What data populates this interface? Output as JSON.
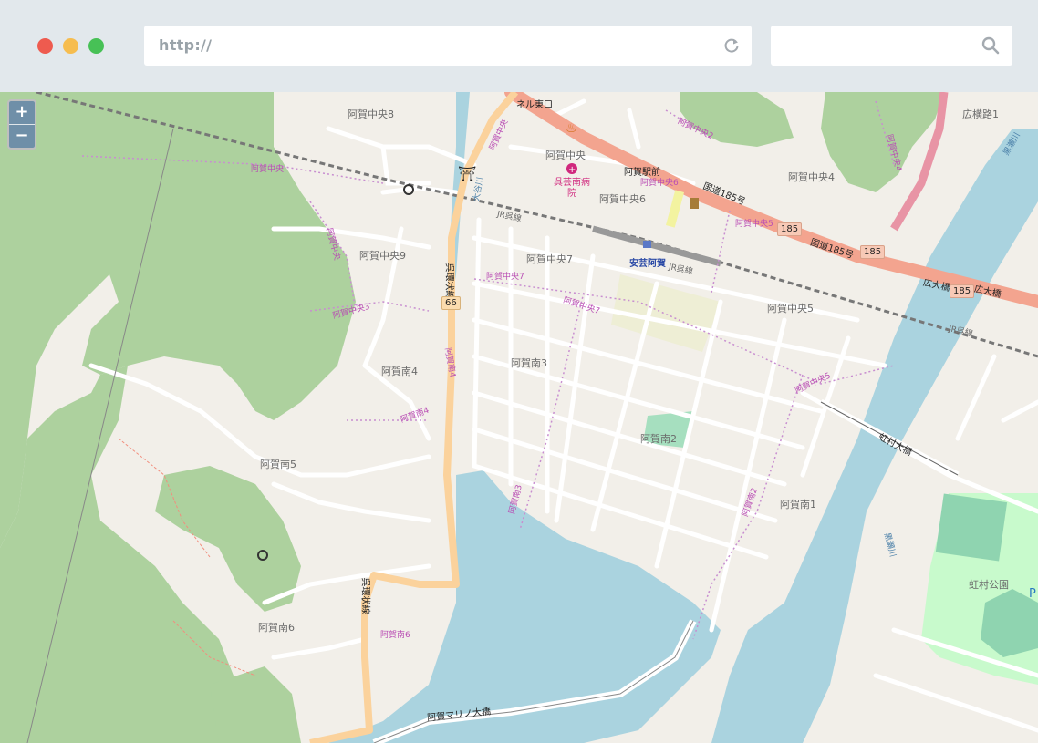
{
  "browser": {
    "url_placeholder": "http://",
    "search_placeholder": "",
    "icons": [
      "close-dot",
      "minimize-dot",
      "maximize-dot",
      "reload-icon",
      "search-icon"
    ],
    "colors": {
      "close": "#ee5b4f",
      "minimize": "#f6bd4f",
      "maximize": "#47c156"
    }
  },
  "map": {
    "zoom_in": "+",
    "zoom_out": "−",
    "labels": {
      "aga_chuo8": "阿賀中央8",
      "aga_chuo": "阿賀中央",
      "aga_chuo6": "阿賀中央6",
      "aga_chuo4": "阿賀中央4",
      "aga_chuo9": "阿賀中央9",
      "aga_chuo7": "阿賀中央7",
      "aga_chuo5": "阿賀中央5",
      "aga_minami4": "阿賀南4",
      "aga_minami3": "阿賀南3",
      "aga_minami2": "阿賀南2",
      "aga_minami5": "阿賀南5",
      "aga_minami1": "阿賀南1",
      "aga_minami6": "阿賀南6",
      "hirokabara": "広横路1",
      "hospital": "呉芸南病院",
      "aga_ekimae": "阿賀駅前",
      "station": "安芸阿賀",
      "jr_line": "JR呉線",
      "route185": "国道185号",
      "hirota_bridge": "広大橋",
      "nijimura_bridge": "虹村大橋",
      "nijimura_park": "虹村公園",
      "kurotsegawa": "黒瀬川",
      "oogawa": "大谷川",
      "tunnel": "ネル東口",
      "kure_hiro_line": "呉環状線",
      "aga_bridge": "阿賀マリノ大橋",
      "park_p": "P",
      "pk_chuo2": "阿賀中央2",
      "pk_chuo": "阿賀中央",
      "pk_chuo6": "阿賀中央6",
      "pk_chuo4": "阿賀中央4",
      "pk_chuo5": "阿賀中央5",
      "pk_chuo7a": "阿賀中央7",
      "pk_chuo7b": "阿賀中央7",
      "pk_minami4": "阿賀南4",
      "pk_minami3": "阿賀南3",
      "pk_minami2": "阿賀南2",
      "pk_minami6": "阿賀南6",
      "pk_chuo_v": "阿賀中央",
      "pk_minami_v": "阿賀南4",
      "pk_chuo5b": "阿賀中央5",
      "pk_chuo3": "阿賀中央3",
      "pk_chuo_s": "阿賀中央"
    },
    "shields": {
      "r185a": "185",
      "r185b": "185",
      "r185c": "185",
      "r66": "66"
    }
  }
}
